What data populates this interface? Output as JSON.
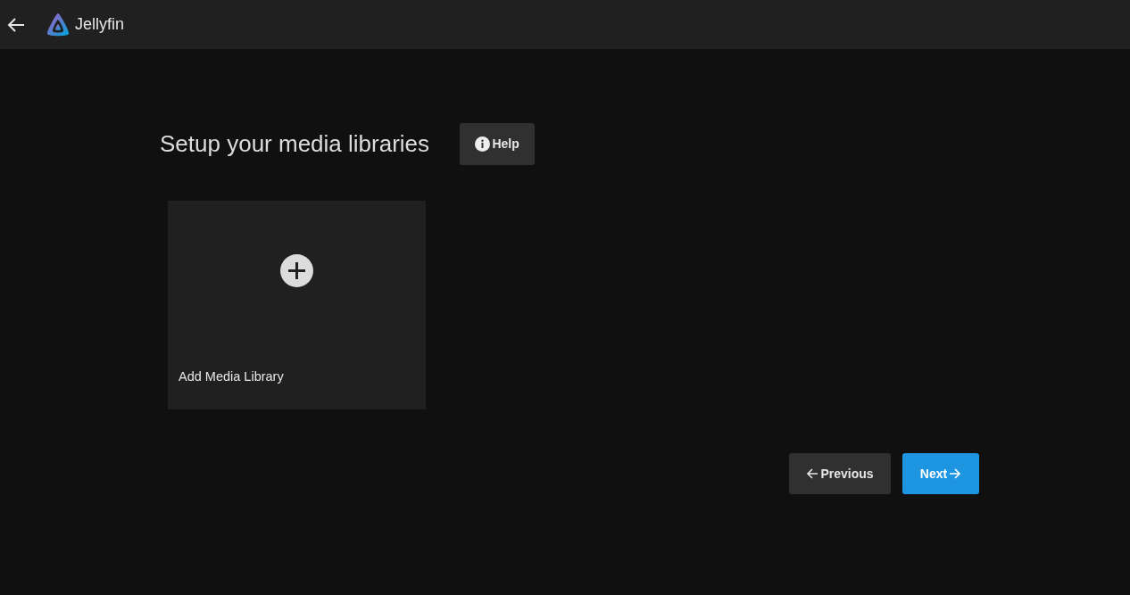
{
  "header": {
    "app_name": "Jellyfin"
  },
  "page": {
    "title": "Setup your media libraries",
    "help_button": "Help"
  },
  "libraries": [
    {
      "label": "Add Media Library",
      "kind": "add"
    }
  ],
  "buttons": [
    {
      "label": "Previous",
      "kind": "previous"
    },
    {
      "label": "Next",
      "kind": "next"
    }
  ]
}
